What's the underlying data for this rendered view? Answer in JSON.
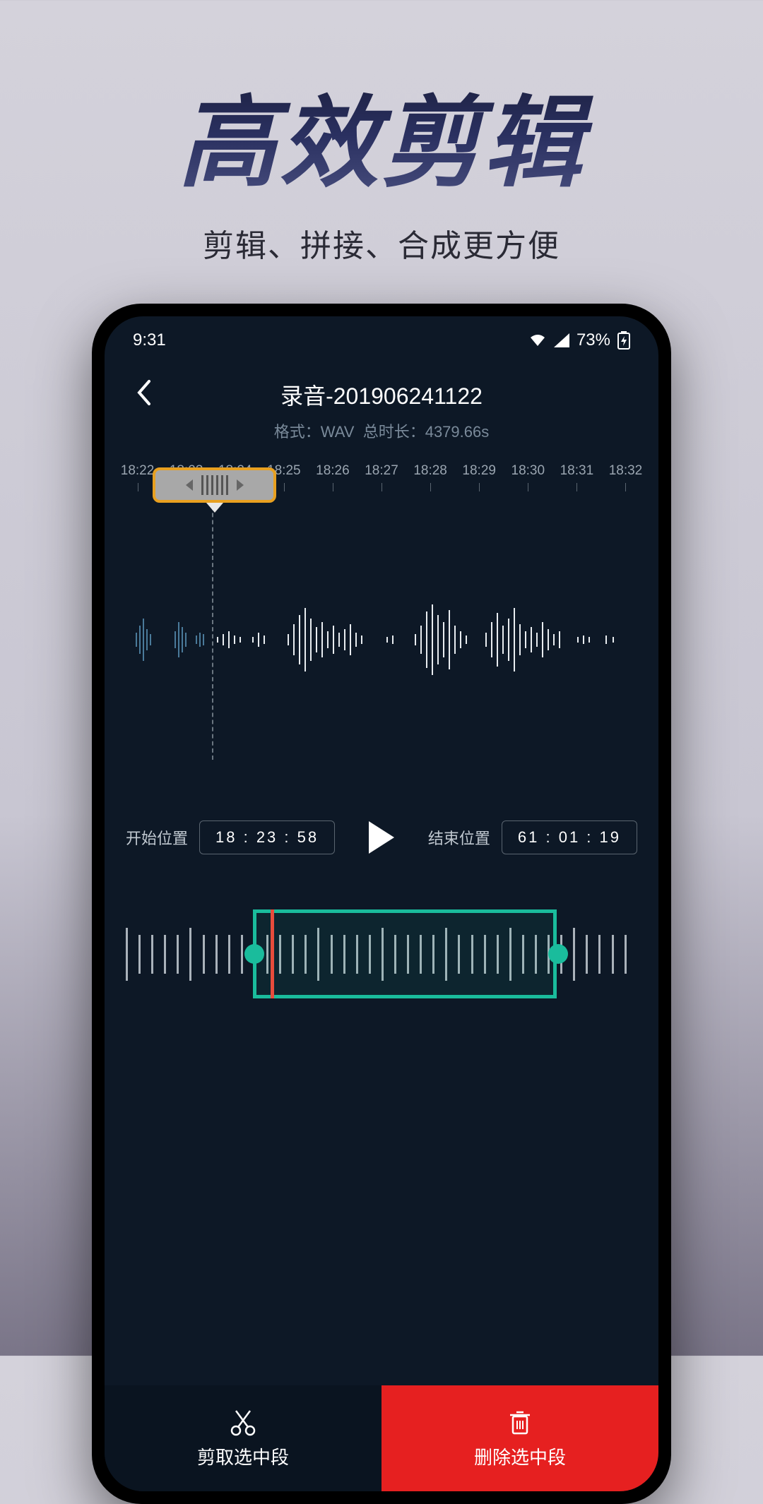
{
  "hero": {
    "title": "高效剪辑",
    "subtitle": "剪辑、拼接、合成更方便"
  },
  "status": {
    "time": "9:31",
    "battery": "73%"
  },
  "appbar": {
    "title": "录音-201906241122",
    "format_label": "格式：",
    "format_value": "WAV",
    "duration_label": "总时长：",
    "duration_value": "4379.66s"
  },
  "ruler": [
    "18:22",
    "18:23",
    "18:24",
    "18:25",
    "18:26",
    "18:27",
    "18:28",
    "18:29",
    "18:30",
    "18:31",
    "18:32"
  ],
  "controls": {
    "start_label": "开始位置",
    "start_value": "18 : 23 : 58",
    "end_label": "结束位置",
    "end_value": "61 : 01 : 19"
  },
  "actions": {
    "cut": "剪取选中段",
    "delete": "删除选中段"
  }
}
